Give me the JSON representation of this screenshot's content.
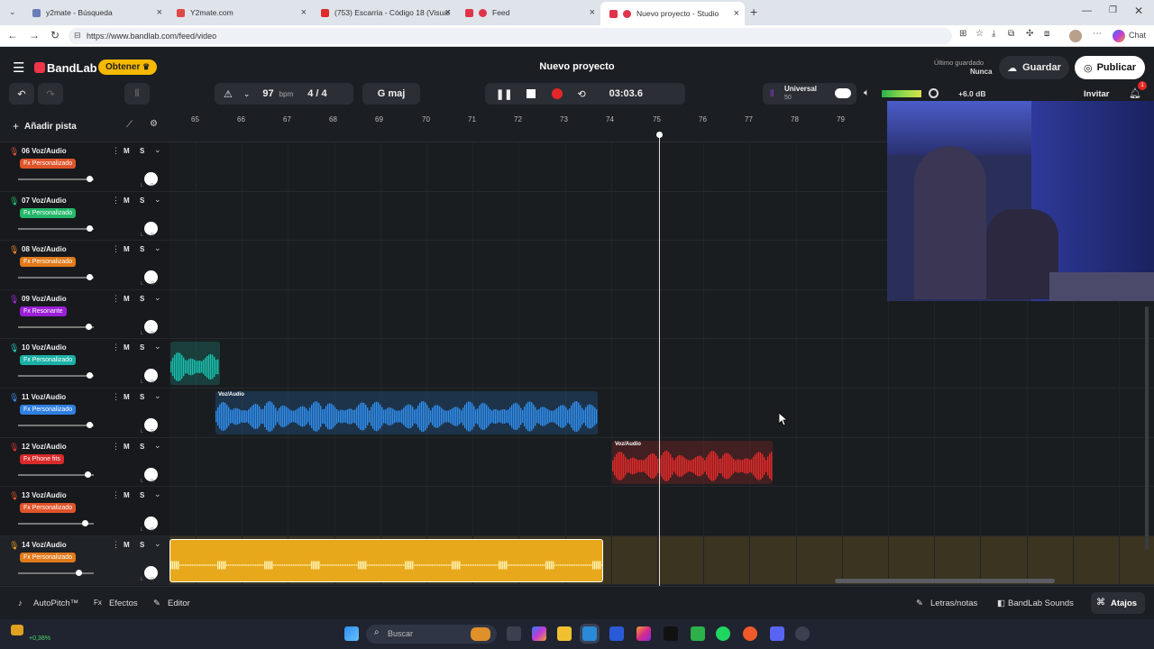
{
  "browser": {
    "tabs": [
      {
        "title": "y2mate - Búsqueda",
        "color": "#6a7cb8"
      },
      {
        "title": "Y2mate.com",
        "color": "#e04848"
      },
      {
        "title": "(753) Escarria - Código 18 (Visuali...",
        "color": "#e02b2b"
      },
      {
        "title": "Feed",
        "color": "#e0344a"
      },
      {
        "title": "Nuevo proyecto - Studio",
        "color": "#e0344a"
      }
    ],
    "url": "https://www.bandlab.com/feed/video",
    "chat_label": "Chat"
  },
  "app": {
    "brand": "BandLab",
    "get_label": "Obtener",
    "project_title": "Nuevo proyecto",
    "last_saved_label": "Último guardado",
    "last_saved_value": "Nunca",
    "save_label": "Guardar",
    "publish_label": "Publicar",
    "invite_label": "Invitar",
    "notif_count": "1"
  },
  "transport": {
    "bpm": "97",
    "bpm_unit": "bpm",
    "signature": "4 / 4",
    "key": "G maj",
    "time": "03:03.6",
    "universal_label": "Universal",
    "universal_value": "50",
    "master_db": "+6.0 dB"
  },
  "toolbar": {
    "add_track_label": "Añadir pista"
  },
  "ruler": [
    "65",
    "66",
    "67",
    "68",
    "69",
    "70",
    "71",
    "72",
    "73",
    "74",
    "75",
    "76",
    "77",
    "78",
    "79"
  ],
  "tracks": [
    {
      "name": "06 Voz/Audio",
      "fx": "Fx Personalizado",
      "fx_color": "#e0542a",
      "icon_color": "#e05a3a",
      "vol": 0.95
    },
    {
      "name": "07 Voz/Audio",
      "fx": "Fx Personalizado",
      "fx_color": "#25b86a",
      "icon_color": "#25c46e",
      "vol": 0.95
    },
    {
      "name": "08 Voz/Audio",
      "fx": "Fx Personalizado",
      "fx_color": "#e07a1c",
      "icon_color": "#f08a2a",
      "vol": 0.95
    },
    {
      "name": "09 Voz/Audio",
      "fx": "Fx Resonante",
      "fx_color": "#9b1fd6",
      "icon_color": "#a82ce0",
      "vol": 0.94
    },
    {
      "name": "10 Voz/Audio",
      "fx": "Fx Personalizado",
      "fx_color": "#1bb0a6",
      "icon_color": "#26c8bb",
      "vol": 0.95
    },
    {
      "name": "11 Voz/Audio",
      "fx": "Fx Personalizado",
      "fx_color": "#2f7fe0",
      "icon_color": "#3a8ef0",
      "vol": 0.95
    },
    {
      "name": "12 Voz/Audio",
      "fx": "Fx Phone fits",
      "fx_color": "#d82a2a",
      "icon_color": "#e23636",
      "vol": 0.92
    },
    {
      "name": "13 Voz/Audio",
      "fx": "Fx Personalizado",
      "fx_color": "#e0542a",
      "icon_color": "#e0542a",
      "vol": 0.89
    },
    {
      "name": "14 Voz/Audio",
      "fx": "Fx Personalizado",
      "fx_color": "#e07a1c",
      "icon_color": "#e8a020",
      "vol": 0.8
    }
  ],
  "clips": [
    {
      "label": "",
      "color": "#19c2b0"
    },
    {
      "label": "Voz/Audio",
      "color": "#2f8ef0"
    },
    {
      "label": "Voz/Audio",
      "color": "#e52a2a"
    },
    {
      "label": "",
      "color": "#e8a81c"
    }
  ],
  "bottom": {
    "autopitch": "AutoPitch™",
    "effects": "Efectos",
    "editor": "Editor",
    "lyrics": "Letras/notas",
    "sounds": "BandLab Sounds",
    "shortcuts": "Atajos"
  },
  "taskbar": {
    "search_placeholder": "Buscar",
    "weather_value": "+0,38%"
  }
}
